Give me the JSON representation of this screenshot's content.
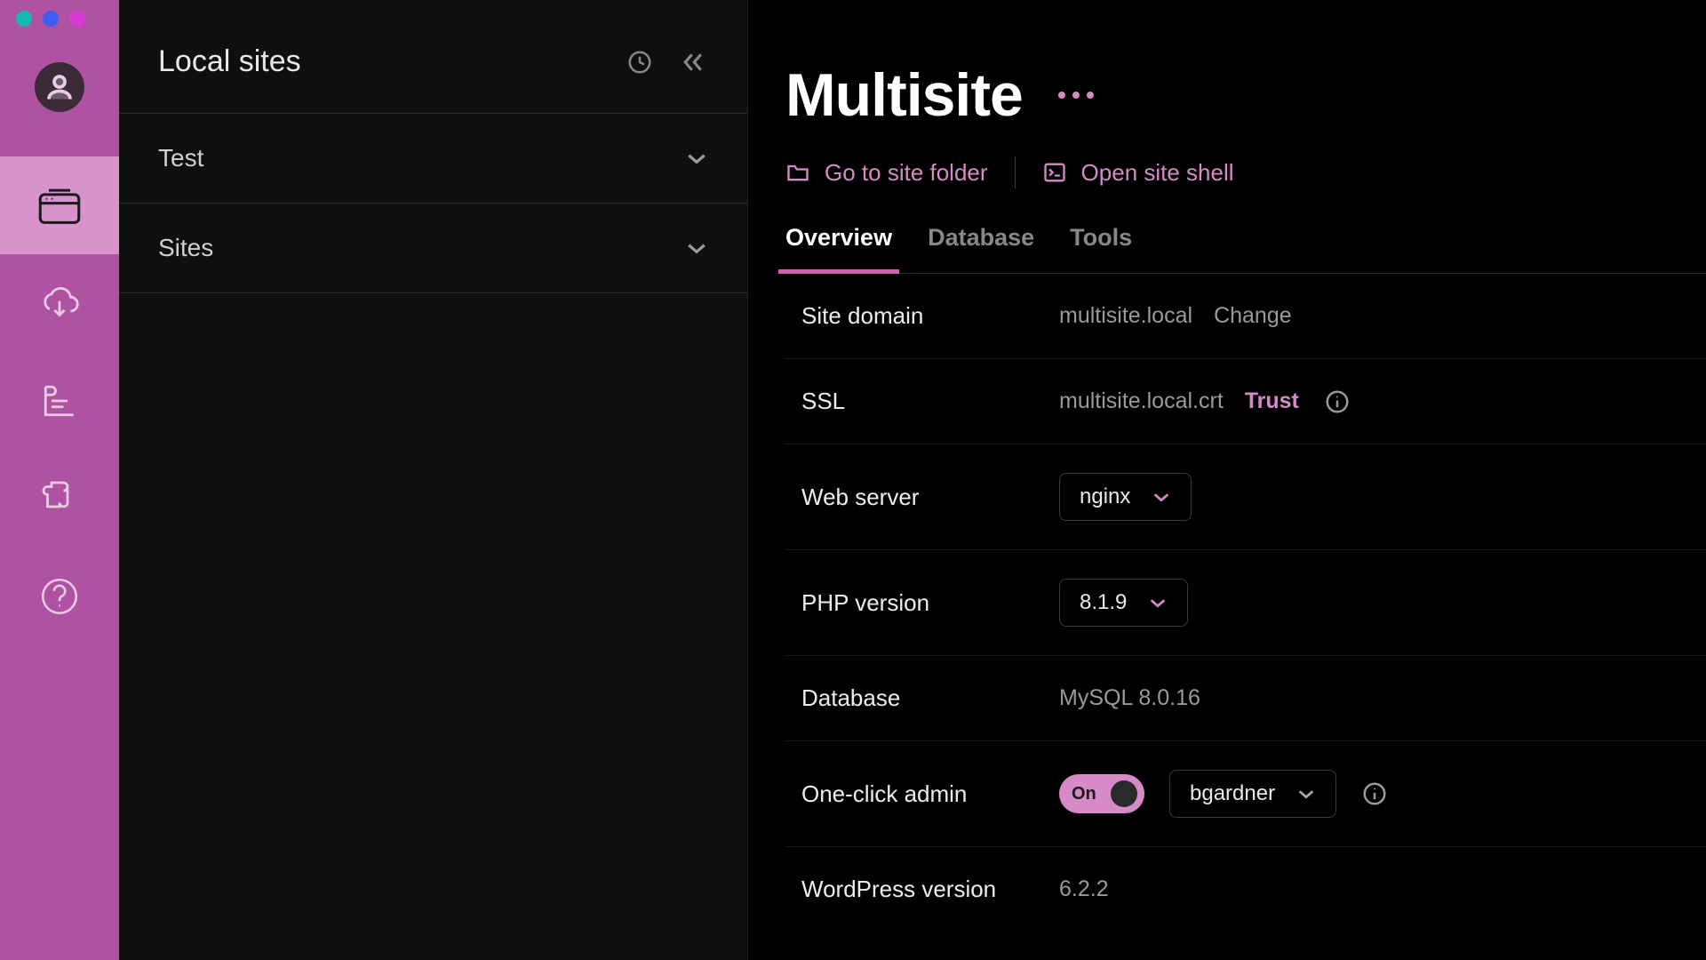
{
  "colors": {
    "accent": "#d68bc8",
    "iconbar": "#af52a1"
  },
  "traffic_lights": [
    "#17b8b0",
    "#3b5ff5",
    "#d63cd4"
  ],
  "sites_panel": {
    "title": "Local sites",
    "groups": [
      {
        "label": "Test"
      },
      {
        "label": "Sites"
      }
    ]
  },
  "site": {
    "title": "Multisite",
    "actions": {
      "folder": "Go to site folder",
      "shell": "Open site shell"
    },
    "tabs": [
      "Overview",
      "Database",
      "Tools"
    ],
    "active_tab": 0,
    "domain": {
      "label": "Site domain",
      "value": "multisite.local",
      "change": "Change"
    },
    "ssl": {
      "label": "SSL",
      "value": "multisite.local.crt",
      "trust": "Trust"
    },
    "webserver": {
      "label": "Web server",
      "value": "nginx"
    },
    "php": {
      "label": "PHP version",
      "value": "8.1.9"
    },
    "database": {
      "label": "Database",
      "value": "MySQL 8.0.16"
    },
    "oneclick": {
      "label": "One-click admin",
      "state": "On",
      "user": "bgardner"
    },
    "wp": {
      "label": "WordPress version",
      "value": "6.2.2"
    }
  }
}
